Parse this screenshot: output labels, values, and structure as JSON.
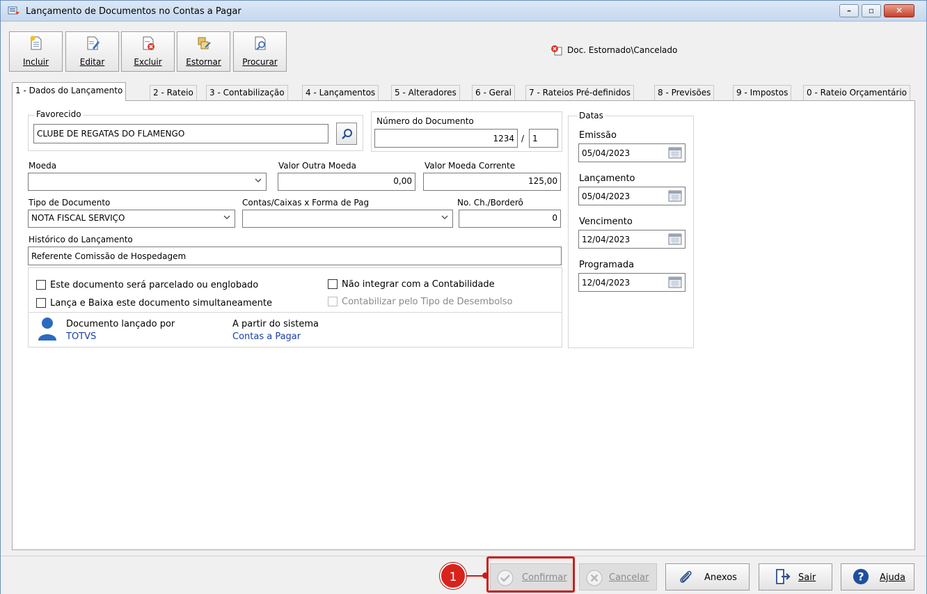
{
  "window": {
    "title": "Lançamento de Documentos no Contas a Pagar",
    "min_glyph": "–",
    "max_glyph": "▫",
    "close_glyph": "✕"
  },
  "toolbar": {
    "buttons": [
      {
        "label": "Incluir",
        "icon": "new-document-icon"
      },
      {
        "label": "Editar",
        "icon": "edit-document-icon"
      },
      {
        "label": "Excluir",
        "icon": "delete-document-icon"
      },
      {
        "label": "Estornar",
        "icon": "reverse-document-icon"
      },
      {
        "label": "Procurar",
        "icon": "search-document-icon"
      }
    ],
    "status_note": "Doc. Estornado\\Cancelado"
  },
  "tabs": [
    "1 - Dados do Lançamento",
    "2 - Rateio",
    "3 - Contabilização",
    "4 - Lançamentos",
    "5 - Alteradores",
    "6 - Geral",
    "7 - Rateios Pré-definidos",
    "8 - Previsões",
    "9 - Impostos",
    "0 - Rateio Orçamentário"
  ],
  "form": {
    "favorecido": {
      "label": "Favorecido",
      "value": "CLUBE DE REGATAS DO FLAMENGO"
    },
    "numero_documento": {
      "label": "Número do Documento",
      "value": "1234",
      "sep": "/",
      "parcela": "1"
    },
    "moeda": {
      "label": "Moeda",
      "value": ""
    },
    "valor_outra_moeda": {
      "label": "Valor Outra Moeda",
      "value": "0,00"
    },
    "valor_moeda_corrente": {
      "label": "Valor Moeda Corrente",
      "value": "125,00"
    },
    "tipo_documento": {
      "label": "Tipo de Documento",
      "value": "NOTA FISCAL SERVIÇO"
    },
    "contas_caixas": {
      "label": "Contas/Caixas x Forma de Pag",
      "value": ""
    },
    "no_cheque": {
      "label": "No. Ch./Borderô",
      "value": "0"
    },
    "historico": {
      "label": "Histórico do Lançamento",
      "value": "Referente Comissão de Hospedagem"
    },
    "checks": {
      "parcelado": {
        "label": "Este documento será parcelado ou englobado",
        "checked": false
      },
      "lanca_baixa": {
        "label": "Lança e Baixa este documento simultaneamente",
        "checked": false
      },
      "nao_integrar": {
        "label": "Não integrar com a Contabilidade",
        "checked": false
      },
      "contabilizar_tipo": {
        "label": "Contabilizar pelo Tipo de Desembolso",
        "checked": false,
        "disabled": true
      }
    },
    "info": {
      "lancado_por_label": "Documento lançado por",
      "lancado_por_value": "TOTVS",
      "sistema_label": "A partir do sistema",
      "sistema_value": "Contas a Pagar"
    }
  },
  "datas": {
    "label": "Datas",
    "emissao": {
      "label": "Emissão",
      "value": "05/04/2023"
    },
    "lancamento": {
      "label": "Lançamento",
      "value": "05/04/2023"
    },
    "vencimento": {
      "label": "Vencimento",
      "value": "12/04/2023"
    },
    "programada": {
      "label": "Programada",
      "value": "12/04/2023"
    }
  },
  "bottom": {
    "confirmar": "Confirmar",
    "cancelar": "Cancelar",
    "anexos": "Anexos",
    "sair": "Sair",
    "ajuda": "Ajuda",
    "callout_number": "1"
  },
  "colors": {
    "accent_red": "#d01818",
    "link_blue": "#1a3fa8",
    "user_icon_blue": "#2a6bc2"
  }
}
